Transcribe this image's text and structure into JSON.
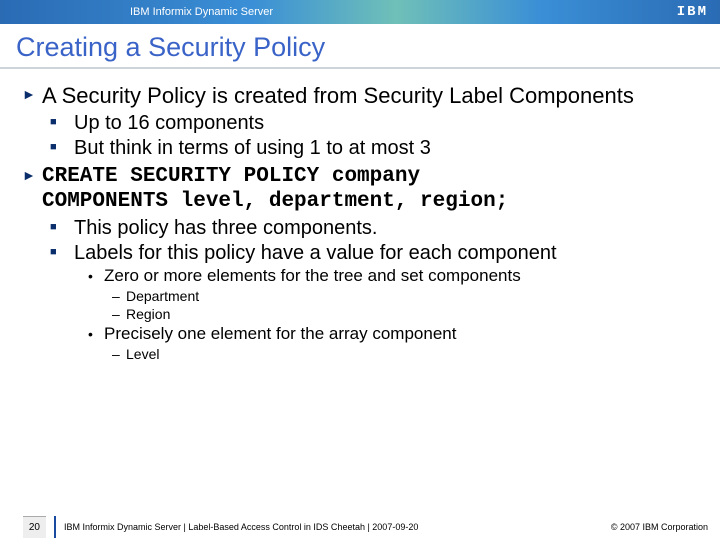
{
  "header": {
    "product": "IBM Informix Dynamic Server",
    "logo": "IBM"
  },
  "title": "Creating a Security Policy",
  "bullets": {
    "b1": "A Security Policy is created from Security Label Components",
    "b1_subs": {
      "s1": "Up to 16 components",
      "s2": "But think in terms of using 1 to at most 3"
    },
    "b2_code1": "CREATE SECURITY POLICY company",
    "b2_code2": "COMPONENTS level, department, region;",
    "b2_subs": {
      "s1": "This policy has three components.",
      "s2": "Labels for this policy have a value for each component"
    },
    "dots": {
      "d1": "Zero or more elements for the tree and set components",
      "d1_dashes": {
        "a": "Department",
        "b": "Region"
      },
      "d2": "Precisely one element for the array component",
      "d2_dashes": {
        "a": "Level"
      }
    }
  },
  "footer": {
    "slide_number": "20",
    "mid": "IBM Informix Dynamic Server | Label-Based Access Control in IDS Cheetah | 2007-09-20",
    "right": "© 2007 IBM Corporation"
  }
}
